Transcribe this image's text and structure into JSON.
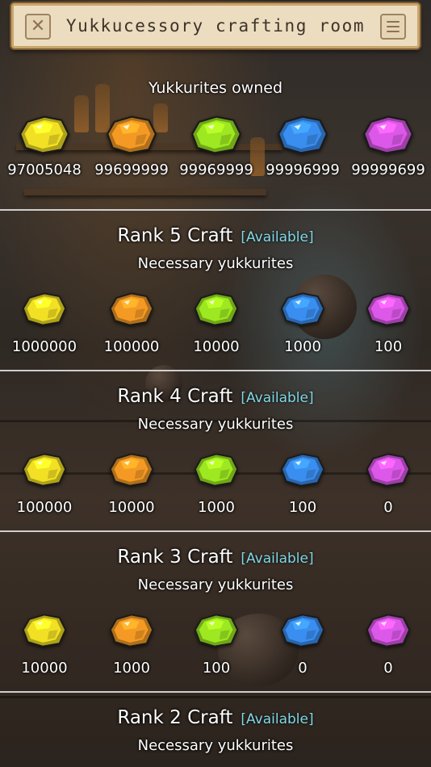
{
  "header": {
    "title": "Yukkucessory crafting room",
    "close_icon": "close-x-icon",
    "menu_icon": "hamburger-menu-icon"
  },
  "gem_colors": {
    "yellow": "#f2e024",
    "orange": "#f49a24",
    "green": "#9de820",
    "blue": "#3a8ef0",
    "purple": "#dc58e8"
  },
  "owned": {
    "label": "Yukkurites owned",
    "values": [
      "97005048",
      "99699999",
      "99969999",
      "99996999",
      "99999699"
    ]
  },
  "ranks": [
    {
      "title": "Rank 5 Craft",
      "status": "[Available]",
      "necessary_label": "Necessary yukkurites",
      "values": [
        "1000000",
        "100000",
        "10000",
        "1000",
        "100"
      ]
    },
    {
      "title": "Rank 4 Craft",
      "status": "[Available]",
      "necessary_label": "Necessary yukkurites",
      "values": [
        "100000",
        "10000",
        "1000",
        "100",
        "0"
      ]
    },
    {
      "title": "Rank 3 Craft",
      "status": "[Available]",
      "necessary_label": "Necessary yukkurites",
      "values": [
        "10000",
        "1000",
        "100",
        "0",
        "0"
      ]
    },
    {
      "title": "Rank 2 Craft",
      "status": "[Available]",
      "necessary_label": "Necessary yukkurites",
      "values": []
    }
  ]
}
